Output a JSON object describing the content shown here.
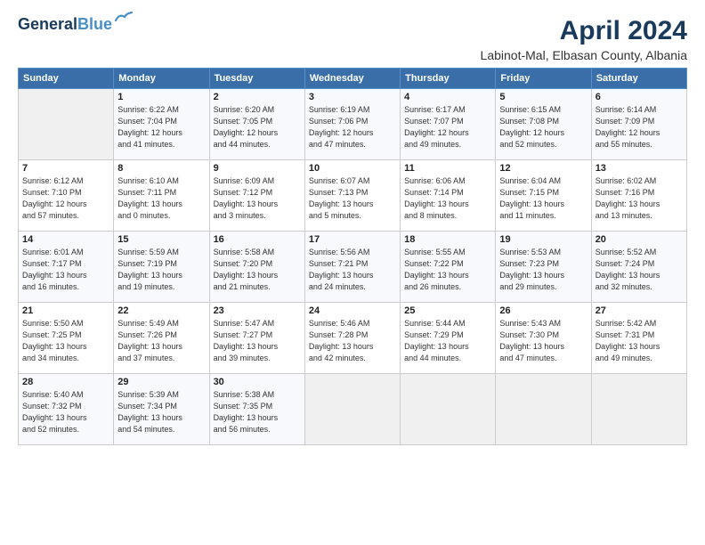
{
  "header": {
    "logo_line1": "General",
    "logo_line2": "Blue",
    "month": "April 2024",
    "location": "Labinot-Mal, Elbasan County, Albania"
  },
  "days_of_week": [
    "Sunday",
    "Monday",
    "Tuesday",
    "Wednesday",
    "Thursday",
    "Friday",
    "Saturday"
  ],
  "weeks": [
    [
      {
        "day": "",
        "info": ""
      },
      {
        "day": "1",
        "info": "Sunrise: 6:22 AM\nSunset: 7:04 PM\nDaylight: 12 hours\nand 41 minutes."
      },
      {
        "day": "2",
        "info": "Sunrise: 6:20 AM\nSunset: 7:05 PM\nDaylight: 12 hours\nand 44 minutes."
      },
      {
        "day": "3",
        "info": "Sunrise: 6:19 AM\nSunset: 7:06 PM\nDaylight: 12 hours\nand 47 minutes."
      },
      {
        "day": "4",
        "info": "Sunrise: 6:17 AM\nSunset: 7:07 PM\nDaylight: 12 hours\nand 49 minutes."
      },
      {
        "day": "5",
        "info": "Sunrise: 6:15 AM\nSunset: 7:08 PM\nDaylight: 12 hours\nand 52 minutes."
      },
      {
        "day": "6",
        "info": "Sunrise: 6:14 AM\nSunset: 7:09 PM\nDaylight: 12 hours\nand 55 minutes."
      }
    ],
    [
      {
        "day": "7",
        "info": "Sunrise: 6:12 AM\nSunset: 7:10 PM\nDaylight: 12 hours\nand 57 minutes."
      },
      {
        "day": "8",
        "info": "Sunrise: 6:10 AM\nSunset: 7:11 PM\nDaylight: 13 hours\nand 0 minutes."
      },
      {
        "day": "9",
        "info": "Sunrise: 6:09 AM\nSunset: 7:12 PM\nDaylight: 13 hours\nand 3 minutes."
      },
      {
        "day": "10",
        "info": "Sunrise: 6:07 AM\nSunset: 7:13 PM\nDaylight: 13 hours\nand 5 minutes."
      },
      {
        "day": "11",
        "info": "Sunrise: 6:06 AM\nSunset: 7:14 PM\nDaylight: 13 hours\nand 8 minutes."
      },
      {
        "day": "12",
        "info": "Sunrise: 6:04 AM\nSunset: 7:15 PM\nDaylight: 13 hours\nand 11 minutes."
      },
      {
        "day": "13",
        "info": "Sunrise: 6:02 AM\nSunset: 7:16 PM\nDaylight: 13 hours\nand 13 minutes."
      }
    ],
    [
      {
        "day": "14",
        "info": "Sunrise: 6:01 AM\nSunset: 7:17 PM\nDaylight: 13 hours\nand 16 minutes."
      },
      {
        "day": "15",
        "info": "Sunrise: 5:59 AM\nSunset: 7:19 PM\nDaylight: 13 hours\nand 19 minutes."
      },
      {
        "day": "16",
        "info": "Sunrise: 5:58 AM\nSunset: 7:20 PM\nDaylight: 13 hours\nand 21 minutes."
      },
      {
        "day": "17",
        "info": "Sunrise: 5:56 AM\nSunset: 7:21 PM\nDaylight: 13 hours\nand 24 minutes."
      },
      {
        "day": "18",
        "info": "Sunrise: 5:55 AM\nSunset: 7:22 PM\nDaylight: 13 hours\nand 26 minutes."
      },
      {
        "day": "19",
        "info": "Sunrise: 5:53 AM\nSunset: 7:23 PM\nDaylight: 13 hours\nand 29 minutes."
      },
      {
        "day": "20",
        "info": "Sunrise: 5:52 AM\nSunset: 7:24 PM\nDaylight: 13 hours\nand 32 minutes."
      }
    ],
    [
      {
        "day": "21",
        "info": "Sunrise: 5:50 AM\nSunset: 7:25 PM\nDaylight: 13 hours\nand 34 minutes."
      },
      {
        "day": "22",
        "info": "Sunrise: 5:49 AM\nSunset: 7:26 PM\nDaylight: 13 hours\nand 37 minutes."
      },
      {
        "day": "23",
        "info": "Sunrise: 5:47 AM\nSunset: 7:27 PM\nDaylight: 13 hours\nand 39 minutes."
      },
      {
        "day": "24",
        "info": "Sunrise: 5:46 AM\nSunset: 7:28 PM\nDaylight: 13 hours\nand 42 minutes."
      },
      {
        "day": "25",
        "info": "Sunrise: 5:44 AM\nSunset: 7:29 PM\nDaylight: 13 hours\nand 44 minutes."
      },
      {
        "day": "26",
        "info": "Sunrise: 5:43 AM\nSunset: 7:30 PM\nDaylight: 13 hours\nand 47 minutes."
      },
      {
        "day": "27",
        "info": "Sunrise: 5:42 AM\nSunset: 7:31 PM\nDaylight: 13 hours\nand 49 minutes."
      }
    ],
    [
      {
        "day": "28",
        "info": "Sunrise: 5:40 AM\nSunset: 7:32 PM\nDaylight: 13 hours\nand 52 minutes."
      },
      {
        "day": "29",
        "info": "Sunrise: 5:39 AM\nSunset: 7:34 PM\nDaylight: 13 hours\nand 54 minutes."
      },
      {
        "day": "30",
        "info": "Sunrise: 5:38 AM\nSunset: 7:35 PM\nDaylight: 13 hours\nand 56 minutes."
      },
      {
        "day": "",
        "info": ""
      },
      {
        "day": "",
        "info": ""
      },
      {
        "day": "",
        "info": ""
      },
      {
        "day": "",
        "info": ""
      }
    ]
  ]
}
